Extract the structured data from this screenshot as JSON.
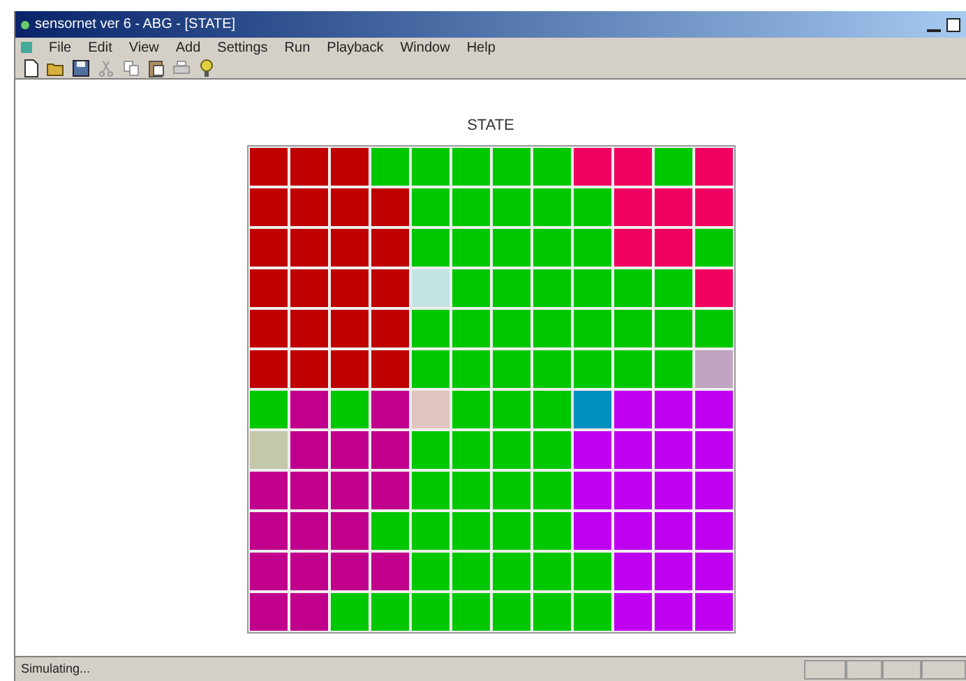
{
  "window": {
    "title": "sensornet ver 6 - ABG - [STATE]"
  },
  "menu": [
    "File",
    "Edit",
    "View",
    "Add",
    "Settings",
    "Run",
    "Playback",
    "Window",
    "Help"
  ],
  "toolbar": [
    {
      "kind": "new"
    },
    {
      "kind": "open"
    },
    {
      "kind": "save"
    },
    {
      "kind": "cut"
    },
    {
      "kind": "copy"
    },
    {
      "kind": "paste"
    },
    {
      "kind": "print"
    },
    {
      "kind": "help"
    }
  ],
  "grid": {
    "title": "STATE",
    "rows": [
      [
        {
          "color": "#c00000"
        },
        {
          "color": "#c00000"
        },
        {
          "color": "#c00000"
        },
        {
          "color": "#00c800"
        },
        {
          "color": "#00c800"
        },
        {
          "color": "#00c800"
        },
        {
          "color": "#00c800"
        },
        {
          "color": "#00c800"
        },
        {
          "color": "#f00060"
        },
        {
          "color": "#f00060"
        },
        {
          "color": "#00c800"
        },
        {
          "color": "#f00060"
        }
      ],
      [
        {
          "color": "#c00000"
        },
        {
          "color": "#c00000"
        },
        {
          "color": "#c00000"
        },
        {
          "color": "#c00000"
        },
        {
          "color": "#00c800"
        },
        {
          "color": "#00c800"
        },
        {
          "color": "#00c800"
        },
        {
          "color": "#00c800"
        },
        {
          "color": "#00c800"
        },
        {
          "color": "#f00060"
        },
        {
          "color": "#f00060"
        },
        {
          "color": "#f00060"
        }
      ],
      [
        {
          "color": "#c00000"
        },
        {
          "color": "#c00000"
        },
        {
          "color": "#c00000"
        },
        {
          "color": "#c00000"
        },
        {
          "color": "#00c800"
        },
        {
          "color": "#00c800"
        },
        {
          "color": "#00c800"
        },
        {
          "color": "#00c800"
        },
        {
          "color": "#00c800"
        },
        {
          "color": "#f00060"
        },
        {
          "color": "#f00060"
        },
        {
          "color": "#00c800"
        }
      ],
      [
        {
          "color": "#c00000"
        },
        {
          "color": "#c00000"
        },
        {
          "color": "#c00000"
        },
        {
          "color": "#c00000"
        },
        {
          "color": "#c4e4e4"
        },
        {
          "color": "#00c800"
        },
        {
          "color": "#00c800"
        },
        {
          "color": "#00c800"
        },
        {
          "color": "#00c800"
        },
        {
          "color": "#00c800"
        },
        {
          "color": "#00c800"
        },
        {
          "color": "#f00060"
        }
      ],
      [
        {
          "color": "#c00000"
        },
        {
          "color": "#c00000"
        },
        {
          "color": "#c00000"
        },
        {
          "color": "#c00000"
        },
        {
          "color": "#00c800"
        },
        {
          "color": "#00c800"
        },
        {
          "color": "#00c800"
        },
        {
          "color": "#00c800"
        },
        {
          "color": "#00c800"
        },
        {
          "color": "#00c800"
        },
        {
          "color": "#00c800"
        },
        {
          "color": "#00c800"
        }
      ],
      [
        {
          "color": "#c00000"
        },
        {
          "color": "#c00000"
        },
        {
          "color": "#c00000"
        },
        {
          "color": "#c00000"
        },
        {
          "color": "#00c800"
        },
        {
          "color": "#00c800"
        },
        {
          "color": "#00c800"
        },
        {
          "color": "#00c800"
        },
        {
          "color": "#00c800"
        },
        {
          "color": "#00c800"
        },
        {
          "color": "#00c800"
        },
        {
          "color": "#c0a4c0"
        }
      ],
      [
        {
          "color": "#00c800"
        },
        {
          "color": "#c0008c"
        },
        {
          "color": "#00c800"
        },
        {
          "color": "#c0008c"
        },
        {
          "color": "#e0c4c0"
        },
        {
          "color": "#00c800"
        },
        {
          "color": "#00c800"
        },
        {
          "color": "#00c800"
        },
        {
          "color": "#0090c0"
        },
        {
          "color": "#c000f0"
        },
        {
          "color": "#c000f0"
        },
        {
          "color": "#c000f0"
        }
      ],
      [
        {
          "color": "#c4c8a8"
        },
        {
          "color": "#c0008c"
        },
        {
          "color": "#c0008c"
        },
        {
          "color": "#c0008c"
        },
        {
          "color": "#00c800"
        },
        {
          "color": "#00c800"
        },
        {
          "color": "#00c800"
        },
        {
          "color": "#00c800"
        },
        {
          "color": "#c000f0"
        },
        {
          "color": "#c000f0"
        },
        {
          "color": "#c000f0"
        },
        {
          "color": "#c000f0"
        }
      ],
      [
        {
          "color": "#c0008c"
        },
        {
          "color": "#c0008c"
        },
        {
          "color": "#c0008c"
        },
        {
          "color": "#c0008c"
        },
        {
          "color": "#00c800"
        },
        {
          "color": "#00c800"
        },
        {
          "color": "#00c800"
        },
        {
          "color": "#00c800"
        },
        {
          "color": "#c000f0"
        },
        {
          "color": "#c000f0"
        },
        {
          "color": "#c000f0"
        },
        {
          "color": "#c000f0"
        }
      ],
      [
        {
          "color": "#c0008c"
        },
        {
          "color": "#c0008c"
        },
        {
          "color": "#c0008c"
        },
        {
          "color": "#00c800"
        },
        {
          "color": "#00c800"
        },
        {
          "color": "#00c800"
        },
        {
          "color": "#00c800"
        },
        {
          "color": "#00c800"
        },
        {
          "color": "#c000f0"
        },
        {
          "color": "#c000f0"
        },
        {
          "color": "#c000f0"
        },
        {
          "color": "#c000f0"
        }
      ],
      [
        {
          "color": "#c0008c"
        },
        {
          "color": "#c0008c"
        },
        {
          "color": "#c0008c"
        },
        {
          "color": "#c0008c"
        },
        {
          "color": "#00c800"
        },
        {
          "color": "#00c800"
        },
        {
          "color": "#00c800"
        },
        {
          "color": "#00c800"
        },
        {
          "color": "#00c800"
        },
        {
          "color": "#c000f0"
        },
        {
          "color": "#c000f0"
        },
        {
          "color": "#c000f0"
        }
      ],
      [
        {
          "color": "#c0008c"
        },
        {
          "color": "#c0008c"
        },
        {
          "color": "#00c800"
        },
        {
          "color": "#00c800"
        },
        {
          "color": "#00c800"
        },
        {
          "color": "#00c800"
        },
        {
          "color": "#00c800"
        },
        {
          "color": "#00c800"
        },
        {
          "color": "#00c800"
        },
        {
          "color": "#c000f0"
        },
        {
          "color": "#c000f0"
        },
        {
          "color": "#c000f0"
        }
      ]
    ]
  },
  "status_bar": {
    "text": "Simulating..."
  }
}
